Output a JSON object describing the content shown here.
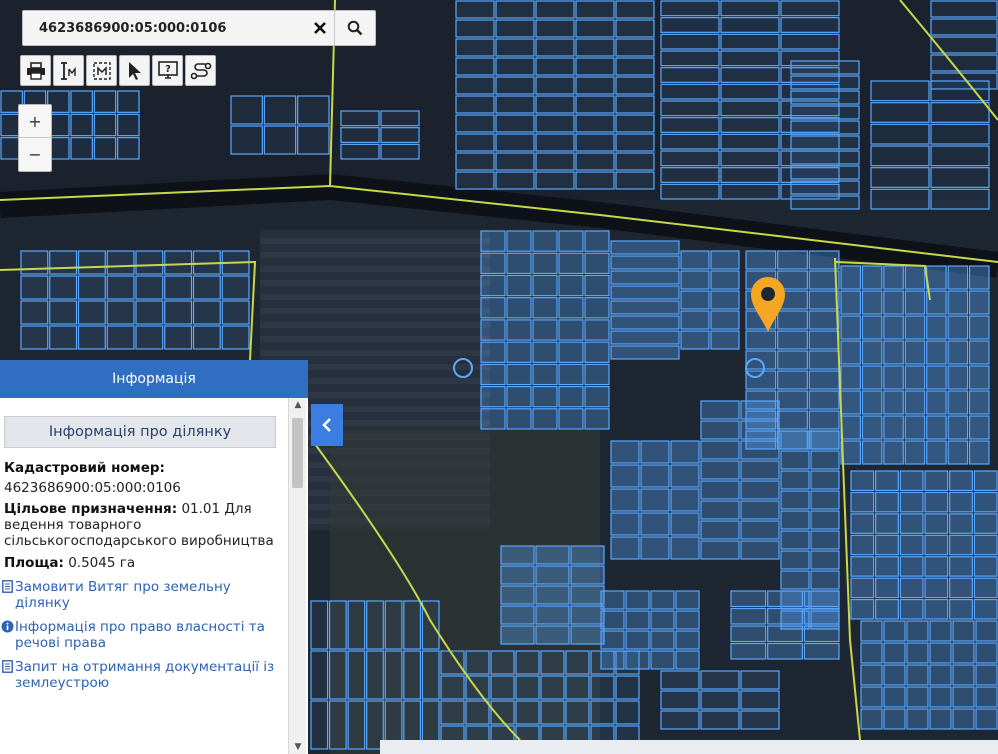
{
  "search": {
    "value": "4623686900:05:000:0106"
  },
  "toolbar": {
    "tools": [
      {
        "icon": "printer-icon"
      },
      {
        "icon": "measure-distance-icon"
      },
      {
        "icon": "measure-area-icon"
      },
      {
        "icon": "pointer-icon"
      },
      {
        "icon": "identify-icon"
      },
      {
        "icon": "route-icon"
      }
    ]
  },
  "zoom": {
    "in_label": "+",
    "out_label": "−"
  },
  "panel": {
    "title": "Інформація",
    "section_title": "Інформація про ділянку",
    "cadastral_label": "Кадастровий номер:",
    "cadastral_value": "4623686900:05:000:0106",
    "purpose_label": "Цільове призначення:",
    "purpose_value": "01.01 Для ведення товарного сільськогосподарського виробництва",
    "area_label": "Площа:",
    "area_value": "0.5045 га",
    "link_extract": "Замовити Витяг про земельну ділянку",
    "link_ownership": "Інформація про право власності та речові права",
    "link_request": "Запит на отримання документації із землеустрою"
  },
  "colors": {
    "accent": "#2f6ec1",
    "parcel": "#5aa8ff",
    "boundary": "#c8d84a",
    "marker": "#f5a623"
  }
}
